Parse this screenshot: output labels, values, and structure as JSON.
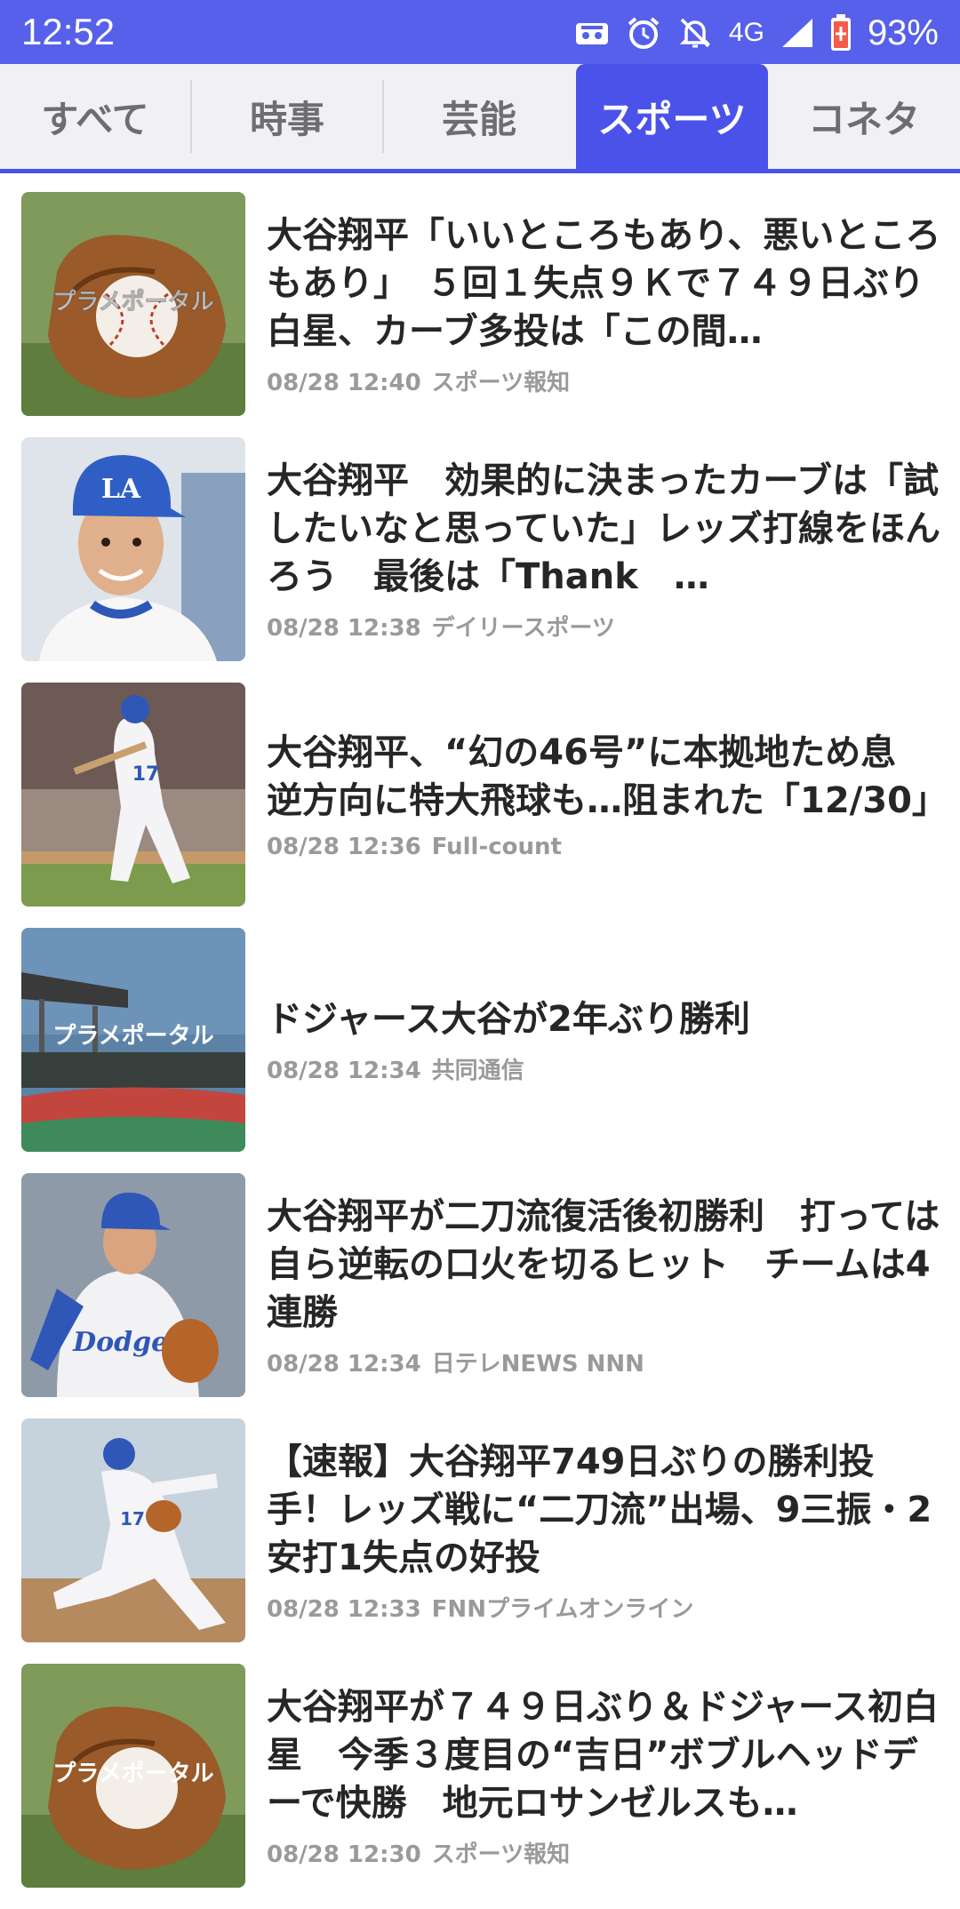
{
  "status": {
    "time": "12:52",
    "network": "4G",
    "battery": "93%"
  },
  "tabs": [
    {
      "label": "すべて",
      "active": false
    },
    {
      "label": "時事",
      "active": false
    },
    {
      "label": "芸能",
      "active": false
    },
    {
      "label": "スポーツ",
      "active": true
    },
    {
      "label": "コネタ",
      "active": false
    }
  ],
  "thumb_label": "プラメポータル",
  "articles": [
    {
      "title": "大谷翔平「いいところもあり、悪いところもあり」　５回１失点９Ｋで７４９日ぶり白星、カーブ多投は「この間…",
      "date": "08/28 12:40",
      "source": "スポーツ報知",
      "thumb": "glove"
    },
    {
      "title": "大谷翔平　効果的に決まったカーブは「試したいなと思っていた」レッズ打線をほんろう　最後は「Thank　…",
      "date": "08/28 12:38",
      "source": "デイリースポーツ",
      "thumb": "portrait"
    },
    {
      "title": "大谷翔平、“幻の46号”に本拠地ため息 逆方向に特大飛球も…阻まれた「12/30」",
      "date": "08/28 12:36",
      "source": "Full-count",
      "thumb": "batter"
    },
    {
      "title": "ドジャース大谷が2年ぶり勝利",
      "date": "08/28 12:34",
      "source": "共同通信",
      "thumb": "stadium"
    },
    {
      "title": "大谷翔平が二刀流復活後初勝利　打っては自ら逆転の口火を切るヒット　チームは4連勝",
      "date": "08/28 12:34",
      "source": "日テレNEWS NNN",
      "thumb": "pitcher"
    },
    {
      "title": "【速報】大谷翔平749日ぶりの勝利投手！レッズ戦に“二刀流”出場、9三振・2安打1失点の好投",
      "date": "08/28 12:33",
      "source": "FNNプライムオンライン",
      "thumb": "pitching"
    },
    {
      "title": "大谷翔平が７４９日ぶり＆ドジャース初白星　今季３度目の“吉日”ボブルヘッドデーで快勝　地元ロサンゼルスも…",
      "date": "08/28 12:30",
      "source": "スポーツ報知",
      "thumb": "glove"
    }
  ],
  "colors": {
    "accent": "#4b52ea",
    "status_bar": "#5660ea",
    "tab_bg": "#f1f1f3",
    "title_text": "#262626",
    "meta_text": "#9a9a9a"
  }
}
